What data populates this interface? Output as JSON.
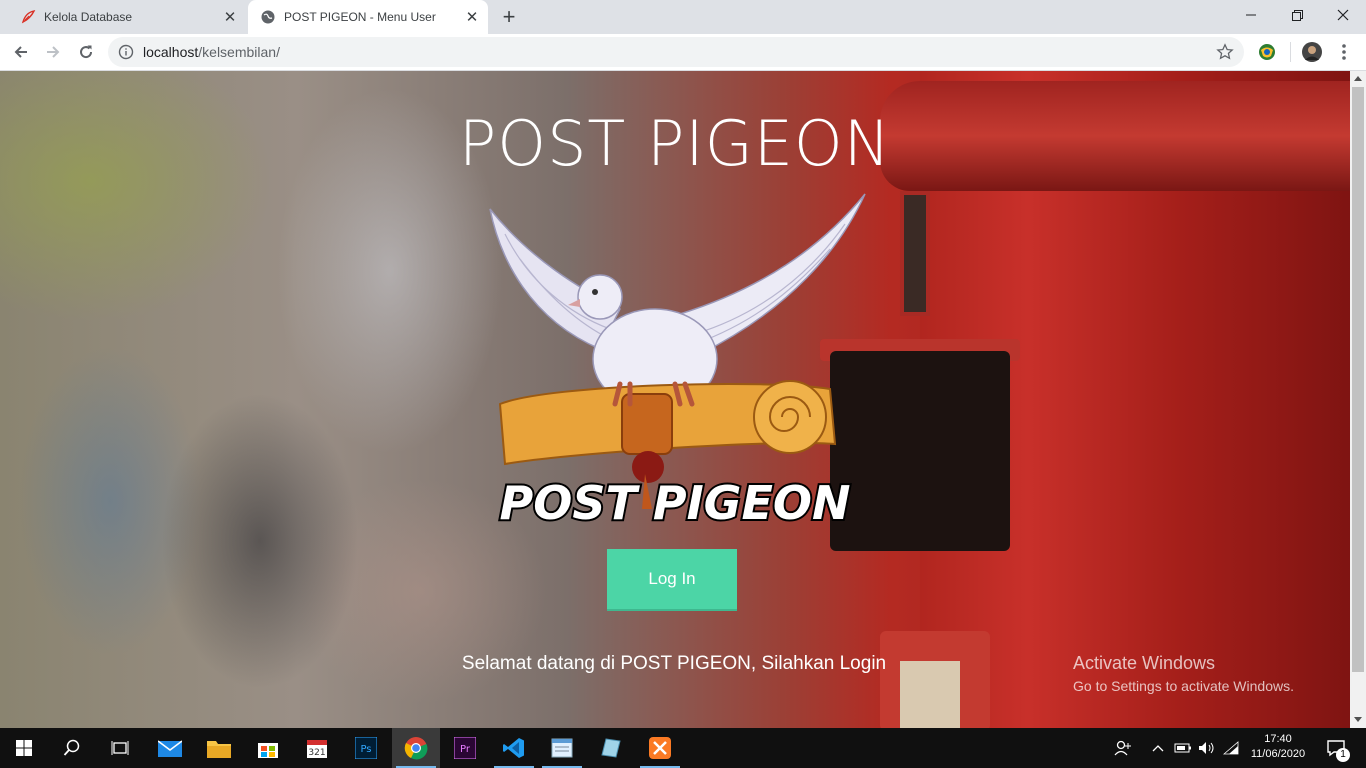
{
  "browser": {
    "tabs": [
      {
        "title": "Kelola Database",
        "active": false,
        "icon": "red-feather-favicon"
      },
      {
        "title": "POST PIGEON - Menu User",
        "active": true,
        "icon": "globe-favicon"
      }
    ],
    "url_host": "localhost",
    "url_path": "/kelsembilan/",
    "colors": {
      "tabstrip": "#dee1e6",
      "omnibox": "#f1f3f4"
    }
  },
  "page": {
    "hero_title": "POST PIGEON",
    "logo_text": "POST PIGEON",
    "login_button": "Log In",
    "welcome_text": "Selamat datang di POST PIGEON, Silahkan Login",
    "colors": {
      "login_button": "#4cd5a6",
      "postbox_red": "#b42a22"
    }
  },
  "watermark": {
    "title": "Activate Windows",
    "subtitle": "Go to Settings to activate Windows."
  },
  "taskbar": {
    "apps": [
      "windows-start-icon",
      "search-icon",
      "task-view-icon",
      "mail-icon",
      "file-explorer-icon",
      "store-icon",
      "calendar-app-icon",
      "photoshop-icon",
      "chrome-icon",
      "premiere-icon",
      "vscode-icon",
      "notepad-icon",
      "box-app-icon",
      "xampp-icon"
    ],
    "time": "17:40",
    "date": "11/06/2020",
    "notification_count": "1"
  }
}
